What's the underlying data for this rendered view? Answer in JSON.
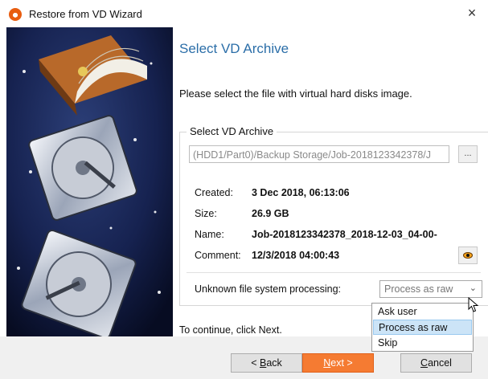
{
  "window": {
    "title": "Restore from VD Wizard",
    "close_glyph": "×"
  },
  "page": {
    "heading": "Select VD Archive",
    "instruction": "Please select the file with virtual hard disks image.",
    "group_title": "Select VD Archive",
    "archive_path": "(HDD1/Part0)/Backup Storage/Job-2018123342378/J",
    "browse_label": "...",
    "details": [
      {
        "label": "Created:",
        "value": "3 Dec 2018, 06:13:06"
      },
      {
        "label": "Size:",
        "value": "26.9 GB"
      },
      {
        "label": "Name:",
        "value": "Job-2018123342378_2018-12-03_04-00-"
      },
      {
        "label": "Comment:",
        "value": "12/3/2018 04:00:43"
      }
    ],
    "fs_label": "Unknown file system processing:",
    "fs_selected": "Process as raw",
    "fs_options": [
      "Ask user",
      "Process as raw",
      "Skip"
    ],
    "continue_text": "To continue, click Next."
  },
  "footer": {
    "back_prefix": "< ",
    "back_mnemonic": "B",
    "back_rest": "ack",
    "next_mnemonic": "N",
    "next_rest": "ext >",
    "cancel_mnemonic": "C",
    "cancel_rest": "ancel"
  },
  "colors": {
    "heading": "#2b6ea8",
    "accent": "#f57b32",
    "dropdown_selected": "#cce4f7"
  },
  "icons": {
    "app": "wizard-app-icon",
    "view": "eye-icon",
    "caret": "chevron-down-icon"
  }
}
